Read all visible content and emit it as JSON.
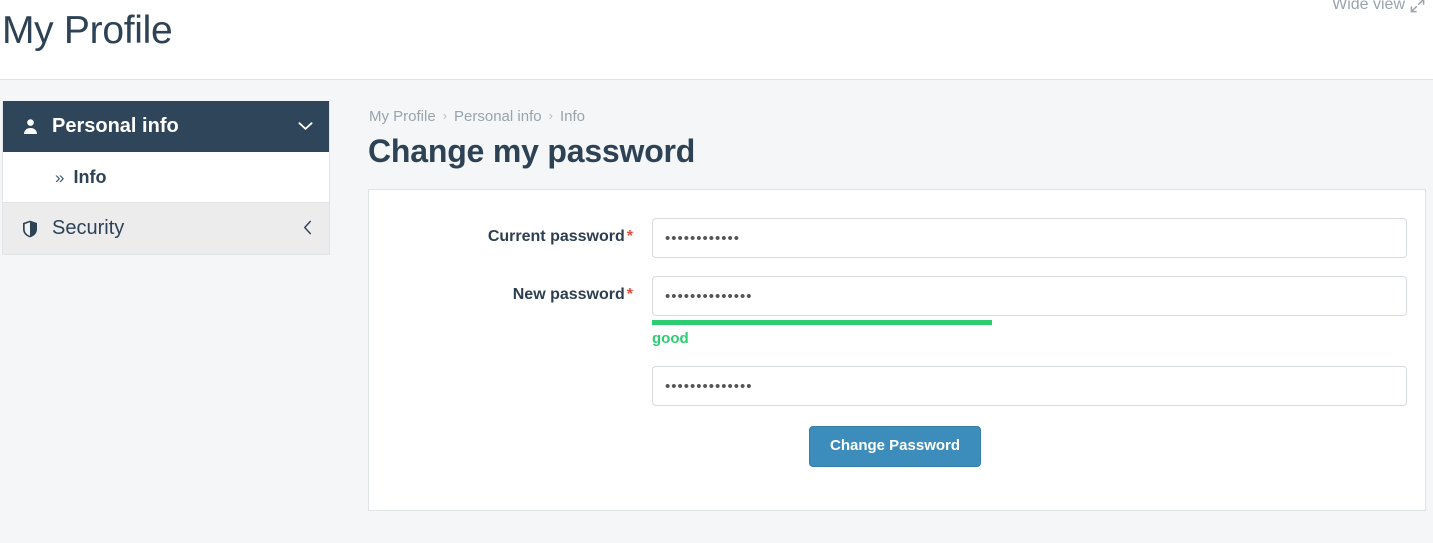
{
  "header": {
    "title": "My Profile",
    "wide_view_label": "Wide view",
    "wide_view_icon": "expand-diagonal-icon"
  },
  "sidebar": {
    "groups": [
      {
        "label": "Personal info",
        "icon": "user-icon",
        "state": "expanded",
        "caret": "⌄",
        "items": [
          {
            "label": "Info",
            "marker": "»",
            "active": true
          }
        ]
      },
      {
        "label": "Security",
        "icon": "shield-icon",
        "state": "collapsed",
        "caret": "‹",
        "items": []
      }
    ]
  },
  "main": {
    "breadcrumb": [
      {
        "label": "My Profile"
      },
      {
        "label": "Personal info"
      },
      {
        "label": "Info"
      }
    ],
    "breadcrumb_separator": "›",
    "title": "Change my password",
    "form": {
      "fields": [
        {
          "name": "current-password",
          "label": "Current password",
          "required": true,
          "required_marker": "*",
          "value": "••••••••••••",
          "placeholder": ""
        },
        {
          "name": "new-password",
          "label": "New password",
          "required": true,
          "required_marker": "*",
          "value": "••••••••••••••",
          "placeholder": "",
          "strength": {
            "text": "good",
            "percent": 45,
            "color": "#2ecc71"
          }
        },
        {
          "name": "confirm-password",
          "label": "",
          "required": false,
          "required_marker": "",
          "value": "••••••••••••••",
          "placeholder": ""
        }
      ],
      "submit_label": "Change Password"
    }
  },
  "colors": {
    "navy": "#2f4559",
    "accent_blue": "#3c8dbc",
    "strength_green": "#2ecc71",
    "required_red": "#e74c3c",
    "muted": "#9aa4ad",
    "page_bg": "#f4f6f7"
  }
}
